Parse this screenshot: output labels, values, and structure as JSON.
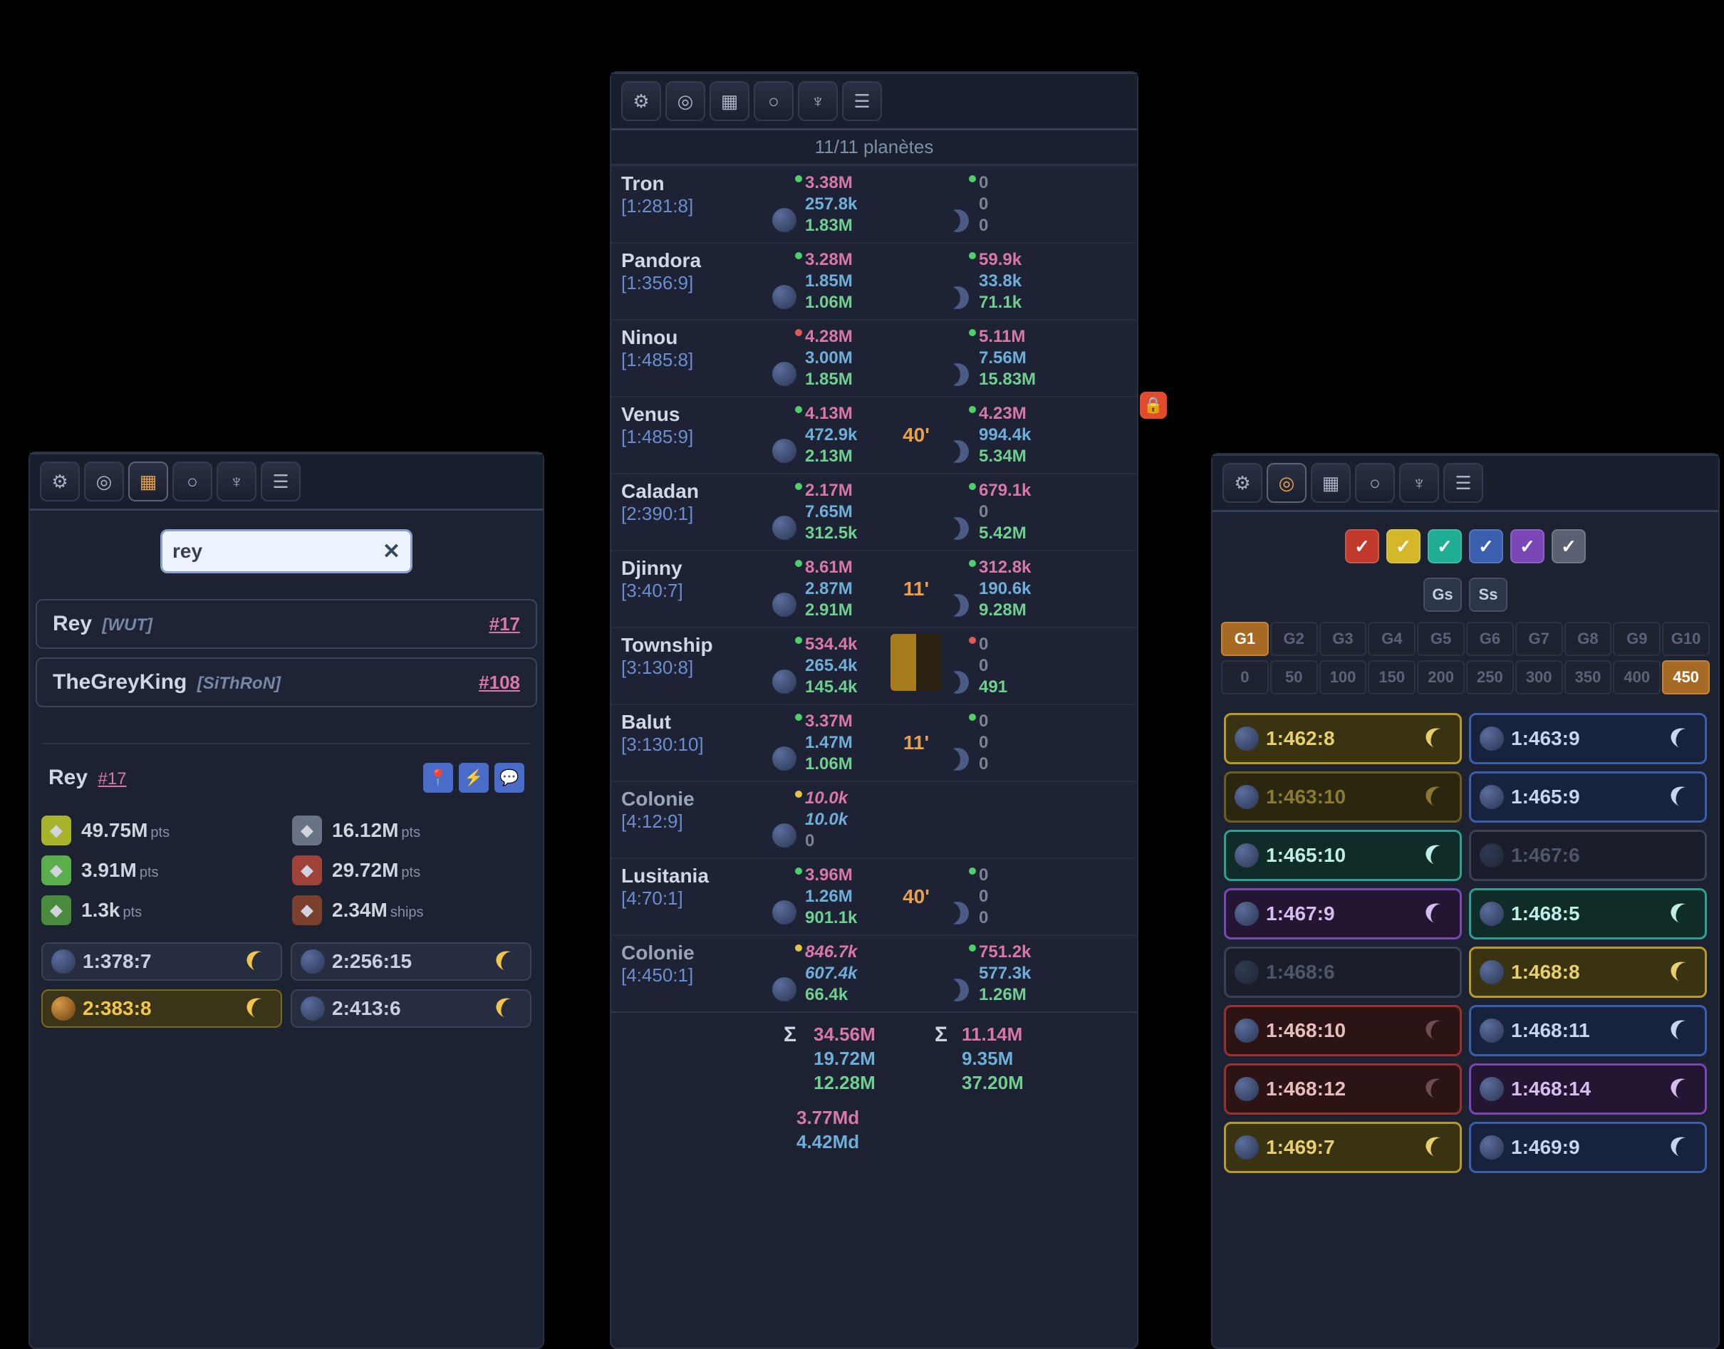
{
  "sub_header": "11/11 planètes",
  "toolbar_icons": [
    "gear",
    "target",
    "flag",
    "ring",
    "wing",
    "layers"
  ],
  "search": {
    "value": "rey",
    "clear_glyph": "✕"
  },
  "results": [
    {
      "name": "Rey",
      "tag": "[WUT]",
      "rank": "#17"
    },
    {
      "name": "TheGreyKing",
      "tag": "[SiThRoN]",
      "rank": "#108"
    }
  ],
  "profile": {
    "name": "Rey",
    "rank": "#17",
    "buttons": [
      "pin",
      "bolt",
      "chat"
    ],
    "stats": [
      {
        "icon_bg": "#a7b42a",
        "value": "49.75M",
        "unit": "pts"
      },
      {
        "icon_bg": "#6a7386",
        "value": "16.12M",
        "unit": "pts"
      },
      {
        "icon_bg": "#5aae4b",
        "value": "3.91M",
        "unit": "pts"
      },
      {
        "icon_bg": "#a14238",
        "value": "29.72M",
        "unit": "pts"
      },
      {
        "icon_bg": "#4a8a3c",
        "value": "1.3k",
        "unit": "pts"
      },
      {
        "icon_bg": "#7b3f2e",
        "value": "2.34M",
        "unit": "ships"
      }
    ],
    "coords": [
      {
        "c": "1:378:7",
        "hl": false,
        "moon": true
      },
      {
        "c": "2:256:15",
        "hl": false,
        "moon": true
      },
      {
        "c": "2:383:8",
        "hl": true,
        "moon": true
      },
      {
        "c": "2:413:6",
        "hl": false,
        "moon": true
      }
    ]
  },
  "planets": [
    {
      "name": "Tron",
      "coord": "[1:281:8]",
      "dp": "g",
      "p": [
        "3.38M",
        "257.8k",
        "1.83M"
      ],
      "t": "",
      "dm": "g",
      "m": [
        "0",
        "0",
        "0"
      ]
    },
    {
      "name": "Pandora",
      "coord": "[1:356:9]",
      "dp": "g",
      "p": [
        "3.28M",
        "1.85M",
        "1.06M"
      ],
      "t": "",
      "dm": "g",
      "m": [
        "59.9k",
        "33.8k",
        "71.1k"
      ]
    },
    {
      "name": "Ninou",
      "coord": "[1:485:8]",
      "dp": "r",
      "p": [
        "4.28M",
        "3.00M",
        "1.85M"
      ],
      "t": "",
      "dm": "g",
      "m": [
        "5.11M",
        "7.56M",
        "15.83M"
      ]
    },
    {
      "name": "Venus",
      "coord": "[1:485:9]",
      "dp": "g",
      "p": [
        "4.13M",
        "472.9k",
        "2.13M"
      ],
      "t": "40'",
      "dm": "g",
      "m": [
        "4.23M",
        "994.4k",
        "5.34M"
      ]
    },
    {
      "name": "Caladan",
      "coord": "[2:390:1]",
      "dp": "g",
      "p": [
        "2.17M",
        "7.65M",
        "312.5k"
      ],
      "t": "",
      "dm": "g",
      "m": [
        "679.1k",
        "0",
        "5.42M"
      ]
    },
    {
      "name": "Djinny",
      "coord": "[3:40:7]",
      "dp": "g",
      "p": [
        "8.61M",
        "2.87M",
        "2.91M"
      ],
      "t": "11'",
      "dm": "g",
      "m": [
        "312.8k",
        "190.6k",
        "9.28M"
      ]
    },
    {
      "name": "Township",
      "coord": "[3:130:8]",
      "dp": "g",
      "p": [
        "534.4k",
        "265.4k",
        "145.4k"
      ],
      "t": "bar",
      "dm": "r",
      "m": [
        "0",
        "0",
        "491"
      ]
    },
    {
      "name": "Balut",
      "coord": "[3:130:10]",
      "dp": "g",
      "p": [
        "3.37M",
        "1.47M",
        "1.06M"
      ],
      "t": "11'",
      "dm": "g",
      "m": [
        "0",
        "0",
        "0"
      ]
    },
    {
      "name": "Colonie",
      "coord": "[4:12:9]",
      "col": true,
      "dp": "y",
      "p_it": true,
      "p": [
        "10.0k",
        "10.0k",
        "0"
      ],
      "no_moon": true
    },
    {
      "name": "Lusitania",
      "coord": "[4:70:1]",
      "dp": "g",
      "p": [
        "3.96M",
        "1.26M",
        "901.1k"
      ],
      "t": "40'",
      "dm": "g",
      "m": [
        "0",
        "0",
        "0"
      ]
    },
    {
      "name": "Colonie",
      "coord": "[4:450:1]",
      "col": true,
      "dp": "y",
      "p": [
        "846.7k",
        "607.4k",
        "66.4k"
      ],
      "p0_it": true,
      "t": "",
      "dm": "g",
      "m": [
        "751.2k",
        "577.3k",
        "1.26M"
      ]
    }
  ],
  "sum": {
    "label": "Σ",
    "p": [
      "34.56M",
      "19.72M",
      "12.28M"
    ],
    "m": [
      "11.14M",
      "9.35M",
      "37.20M"
    ]
  },
  "grand": [
    "3.77Md",
    "4.42Md"
  ],
  "right": {
    "checks": [
      {
        "bg": "#c0392b"
      },
      {
        "bg": "#d4b82a"
      },
      {
        "bg": "#1fae95"
      },
      {
        "bg": "#3a5fae"
      },
      {
        "bg": "#7b46b5"
      },
      {
        "bg": "#5a6172"
      }
    ],
    "gs": [
      "Gs",
      "Ss"
    ],
    "g_row": [
      "G1",
      "G2",
      "G3",
      "G4",
      "G5",
      "G6",
      "G7",
      "G8",
      "G9",
      "G10"
    ],
    "g_sel": 0,
    "n_row": [
      "0",
      "50",
      "100",
      "150",
      "200",
      "250",
      "300",
      "350",
      "400",
      "450"
    ],
    "n_sel": 9,
    "targets": [
      {
        "c": "1:462:8",
        "cls": "t-yellow",
        "moon": true
      },
      {
        "c": "1:463:9",
        "cls": "t-blue",
        "moon": true
      },
      {
        "c": "1:463:10",
        "cls": "t-yellow-d",
        "moon": true
      },
      {
        "c": "1:465:9",
        "cls": "t-blue",
        "moon": true
      },
      {
        "c": "1:465:10",
        "cls": "t-teal",
        "moon": true
      },
      {
        "c": "1:467:6",
        "cls": "t-grey",
        "moon": false,
        "dim": true
      },
      {
        "c": "1:467:9",
        "cls": "t-purple",
        "moon": true
      },
      {
        "c": "1:468:5",
        "cls": "t-teal",
        "moon": true
      },
      {
        "c": "1:468:6",
        "cls": "t-grey",
        "moon": false,
        "dim": true
      },
      {
        "c": "1:468:8",
        "cls": "t-yellow",
        "moon": true
      },
      {
        "c": "1:468:10",
        "cls": "t-red",
        "moon": true
      },
      {
        "c": "1:468:11",
        "cls": "t-blue",
        "moon": true
      },
      {
        "c": "1:468:12",
        "cls": "t-red",
        "moon": true
      },
      {
        "c": "1:468:14",
        "cls": "t-purple",
        "moon": true
      },
      {
        "c": "1:469:7",
        "cls": "t-yellow",
        "moon": true
      },
      {
        "c": "1:469:9",
        "cls": "t-blue",
        "moon": true
      }
    ]
  },
  "lock_glyph": "🔒"
}
